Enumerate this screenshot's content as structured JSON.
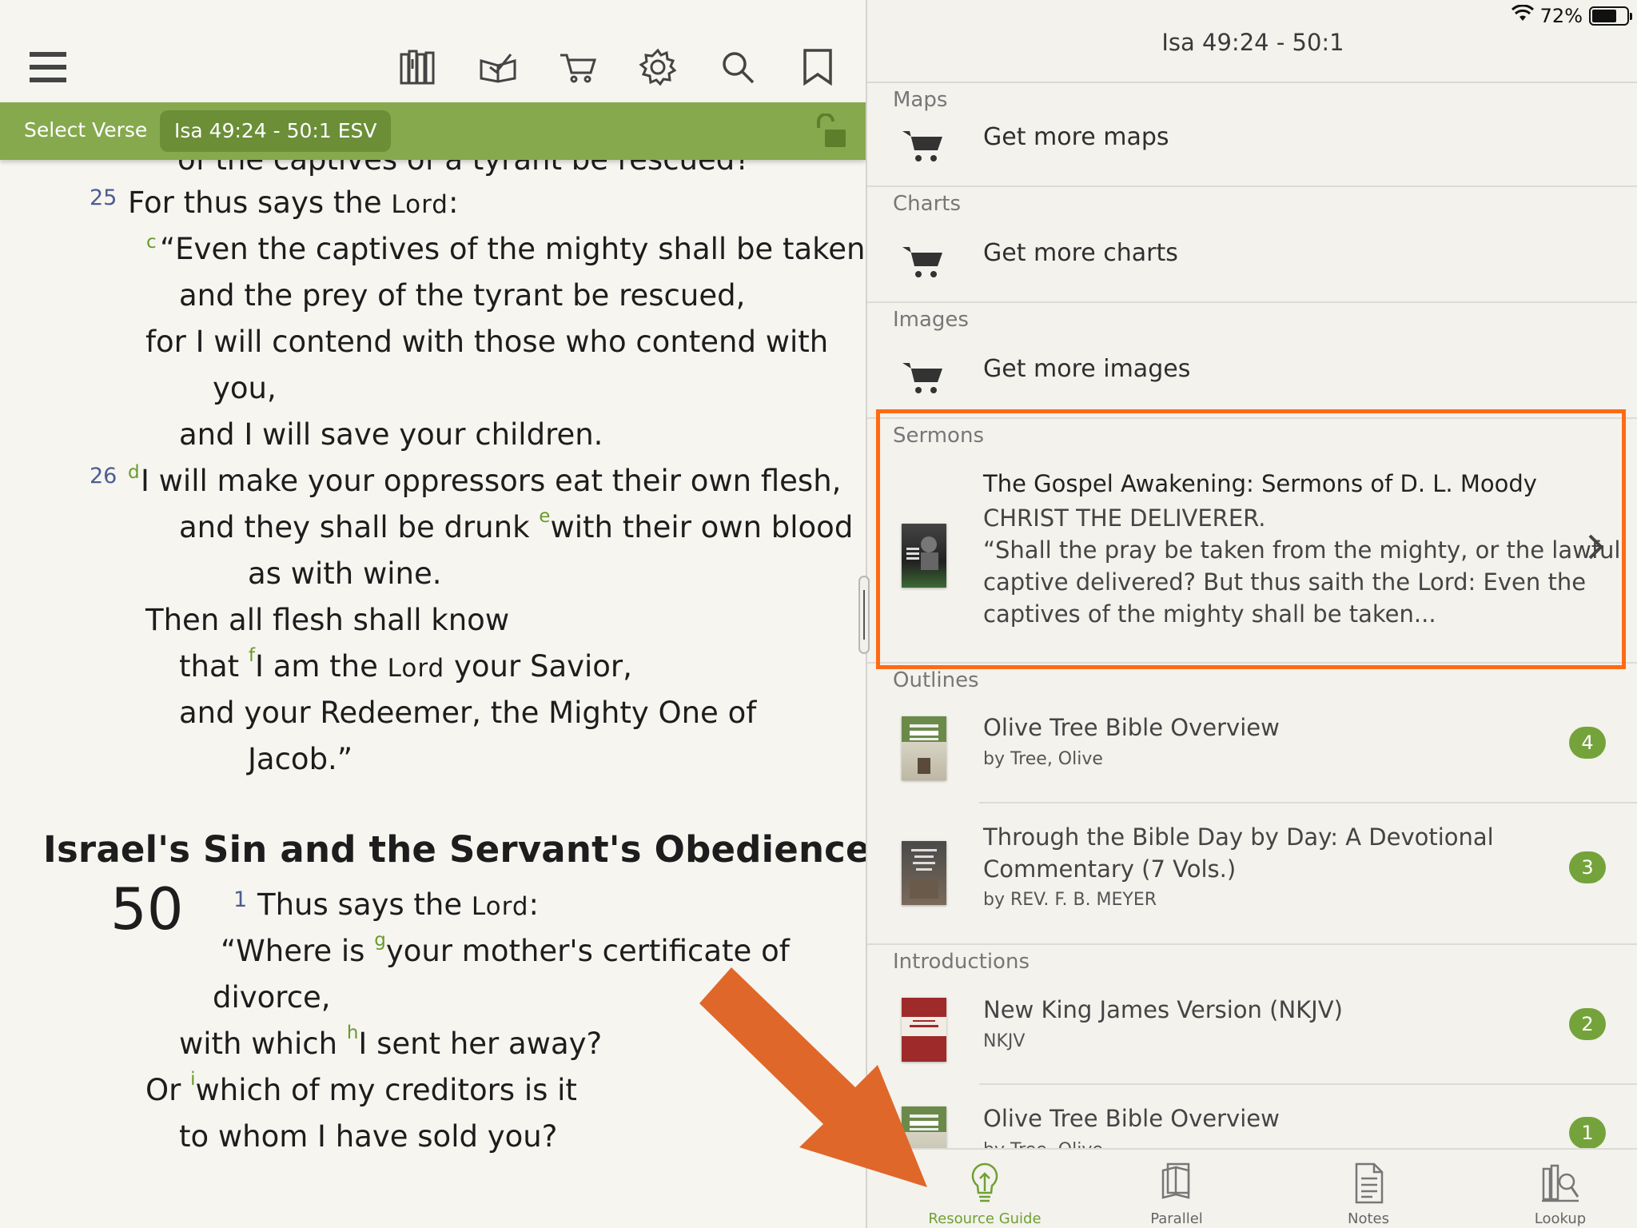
{
  "left_pane": {
    "toolbar": {
      "icons": [
        "menu-icon",
        "library-icon",
        "reading-plans-icon",
        "store-cart-icon",
        "settings-gear-icon",
        "search-icon",
        "bookmark-icon"
      ]
    },
    "verse_bar": {
      "select_label": "Select Verse",
      "reference": "Isa 49:24 - 50:1 ESV"
    },
    "cutoff_line": "of the captives of a tyrant be rescued?",
    "verse_25_num": "25",
    "verse_25": {
      "l1_a": "For thus says the ",
      "lord": "Lord",
      "l1_b": ":",
      "fn_c": "c",
      "l2": "“Even the captives of the mighty shall be taken,",
      "l3": "and the prey of the tyrant be rescued,",
      "l4": "for I will contend with those who contend with",
      "l5": "you,",
      "l6": "and I will save your children."
    },
    "verse_26_num": "26",
    "verse_26": {
      "fn_d": "d",
      "l1": "I will make your oppressors eat their own flesh,",
      "l2_a": "and they shall be drunk ",
      "fn_e": "e",
      "l2_b": "with their own blood",
      "l3": "as with wine.",
      "l4": "Then all flesh shall know",
      "l5_a": "that ",
      "fn_f": "f",
      "l5_b": "I am the ",
      "lord": "Lord",
      "l5_c": " your Savior,",
      "l6": "and your Redeemer, the Mighty One of",
      "l7": "Jacob.”"
    },
    "heading": "Israel's Sin and the Servant's Obedience",
    "chapter_num": "50",
    "verse_1_num": "1",
    "verse_1": {
      "l1_a": "Thus says the ",
      "lord": "Lord",
      "l1_b": ":",
      "l2_a": "“Where is ",
      "fn_g": "g",
      "l2_b": "your mother's certificate of",
      "l3": "divorce,",
      "l4_a": "with which ",
      "fn_h": "h",
      "l4_b": "I sent her away?",
      "l5_a": "Or ",
      "fn_i": "i",
      "l5_b": "which of my creditors is it",
      "l6": "to whom I have sold you?"
    }
  },
  "status_bar": {
    "battery": "72%",
    "battery_level": 0.72
  },
  "resource_guide": {
    "title": "Isa 49:24 - 50:1",
    "maps": {
      "label": "Maps",
      "action": "Get more maps"
    },
    "charts": {
      "label": "Charts",
      "action": "Get more charts"
    },
    "images": {
      "label": "Images",
      "action": "Get more images"
    },
    "sermons": {
      "label": "Sermons",
      "item": {
        "title": "The Gospel Awakening: Sermons of D. L. Moody",
        "subtitle": "CHRIST THE DELIVERER.",
        "excerpt_1": "“Shall the pray be taken from the mighty, or the lawful",
        "excerpt_2": "captive delivered? But thus saith the Lord: Even the",
        "excerpt_3": "captives of the mighty shall be taken..."
      }
    },
    "outlines": {
      "label": "Outlines",
      "items": [
        {
          "title": "Olive Tree Bible Overview",
          "author": "by Tree, Olive",
          "count": "4"
        },
        {
          "title_1": "Through the Bible Day by Day: A Devotional",
          "title_2": "Commentary (7 Vols.)",
          "author": "by REV. F. B. MEYER",
          "count": "3"
        }
      ]
    },
    "introductions": {
      "label": "Introductions",
      "items": [
        {
          "title": "New King James Version (NKJV)",
          "author": "NKJV",
          "count": "2"
        },
        {
          "title": "Olive Tree Bible Overview",
          "author": "by Tree, Olive",
          "count": "1"
        }
      ]
    }
  },
  "tabbar": {
    "tabs": [
      {
        "label": "Resource Guide",
        "icon": "lightbulb-icon",
        "active": true
      },
      {
        "label": "Parallel",
        "icon": "parallel-books-icon",
        "active": false
      },
      {
        "label": "Notes",
        "icon": "notes-icon",
        "active": false
      },
      {
        "label": "Lookup",
        "icon": "lookup-icon",
        "active": false
      }
    ]
  },
  "colors": {
    "accent_green": "#86a94e",
    "badge_green": "#74a33b",
    "annotation_orange": "#ff6a13",
    "arrow_orange": "#e0672a"
  }
}
